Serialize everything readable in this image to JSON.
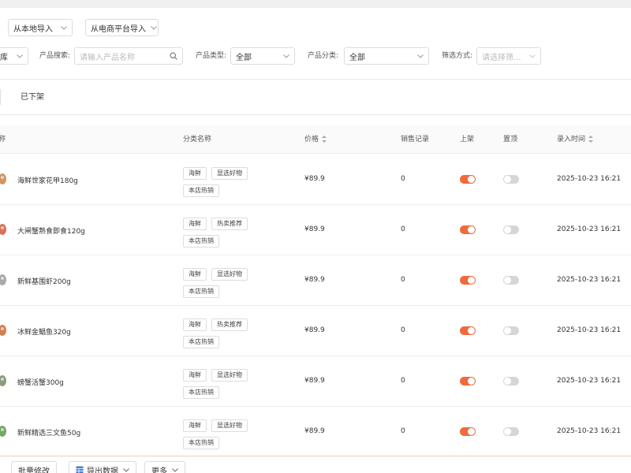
{
  "toolbar": {
    "import_local": "从本地导入",
    "import_platform": "从电商平台导入"
  },
  "filters": {
    "store_partial": "库",
    "search_label": "产品搜索:",
    "search_placeholder": "请输入产品名称",
    "type_label": "产品类型:",
    "type_value": "全部",
    "category_label": "产品分类:",
    "category_value": "全部",
    "filter_label": "筛选方式:",
    "filter_placeholder": "请选择筛..."
  },
  "tabs": {
    "delisted": "已下架"
  },
  "table": {
    "headers": {
      "name_partial": "称",
      "category": "分类名称",
      "price": "价格",
      "sales": "销售记录",
      "listed": "上架",
      "pinned": "置顶",
      "created": "录入时间"
    },
    "rows": [
      {
        "name": "海鲜世家花甲180g",
        "tags": [
          "海鲜",
          "显选好物",
          "本店热销"
        ],
        "price": "¥89.9",
        "sales": "0",
        "listed": true,
        "pinned": false,
        "time": "2025-10-23 16:21"
      },
      {
        "name": "大闸蟹熟食即食120g",
        "tags": [
          "海鲜",
          "热卖推荐",
          "本店热销"
        ],
        "price": "¥89.9",
        "sales": "0",
        "listed": true,
        "pinned": false,
        "time": "2025-10-23 16:21"
      },
      {
        "name": "新鲜基围虾200g",
        "tags": [
          "海鲜",
          "显选好物",
          "本店热销"
        ],
        "price": "¥89.9",
        "sales": "0",
        "listed": true,
        "pinned": false,
        "time": "2025-10-23 16:21"
      },
      {
        "name": "冰鲜金鲳鱼320g",
        "tags": [
          "海鲜",
          "热卖推荐",
          "本店热销"
        ],
        "price": "¥89.9",
        "sales": "0",
        "listed": true,
        "pinned": false,
        "time": "2025-10-23 16:21"
      },
      {
        "name": "螃蟹活蟹300g",
        "tags": [
          "海鲜",
          "显选好物",
          "本店热销"
        ],
        "price": "¥89.9",
        "sales": "0",
        "listed": true,
        "pinned": false,
        "time": "2025-10-23 16:21"
      },
      {
        "name": "新鲜精选三文鱼50g",
        "tags": [
          "海鲜",
          "显选好物",
          "本店热销"
        ],
        "price": "¥89.9",
        "sales": "0",
        "listed": true,
        "pinned": false,
        "time": "2025-10-23 16:21"
      }
    ]
  },
  "footer": {
    "batch_edit": "批量修改",
    "export": "导出数据",
    "more": "更多"
  },
  "colors": {
    "accent": "#f06a3c",
    "switch_off": "#d6d6d6"
  }
}
